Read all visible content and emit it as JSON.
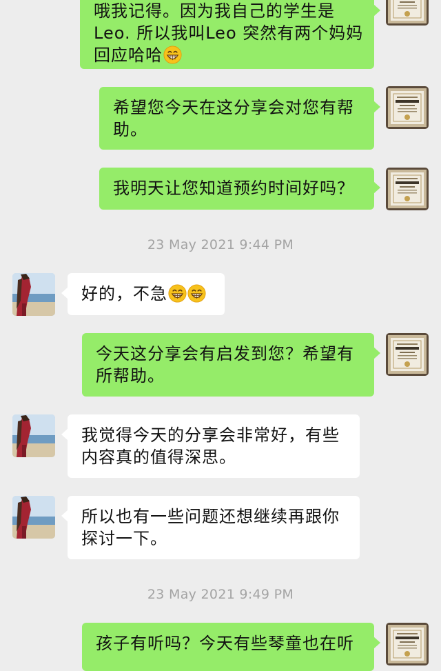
{
  "messages": [
    {
      "lines": [
        "哦我记得。因为我自己的学生是",
        "Leo. 所以我叫Leo 突然有两个妈妈",
        "回应哈哈"
      ]
    },
    {
      "lines": [
        "希望您今天在这分享会对您有帮",
        "助。"
      ]
    },
    {
      "lines": [
        "我明天让您知道预约时间好吗？"
      ]
    },
    {
      "lines": [
        "好的，不急"
      ]
    },
    {
      "lines": [
        "今天这分享会有启发到您？希望有",
        "所帮助。"
      ]
    },
    {
      "lines": [
        "我觉得今天的分享会非常好，有些",
        "内容真的值得深思。"
      ]
    },
    {
      "lines": [
        "所以也有一些问题还想继续再跟你",
        "探讨一下。"
      ]
    },
    {
      "lines": [
        "孩子有听吗？今天有些琴童也在听"
      ]
    }
  ],
  "timestamps": [
    "23 May 2021 9:44 PM",
    "23 May 2021 9:49 PM"
  ],
  "colors": {
    "background": "#ededed",
    "sent_bubble": "#95ec69",
    "received_bubble": "#ffffff",
    "timestamp": "#a3a3a3"
  },
  "icons": {
    "self_avatar": "certificate-avatar",
    "other_avatar": "beach-photo-avatar",
    "emoji": "grinning-face-emoji"
  }
}
